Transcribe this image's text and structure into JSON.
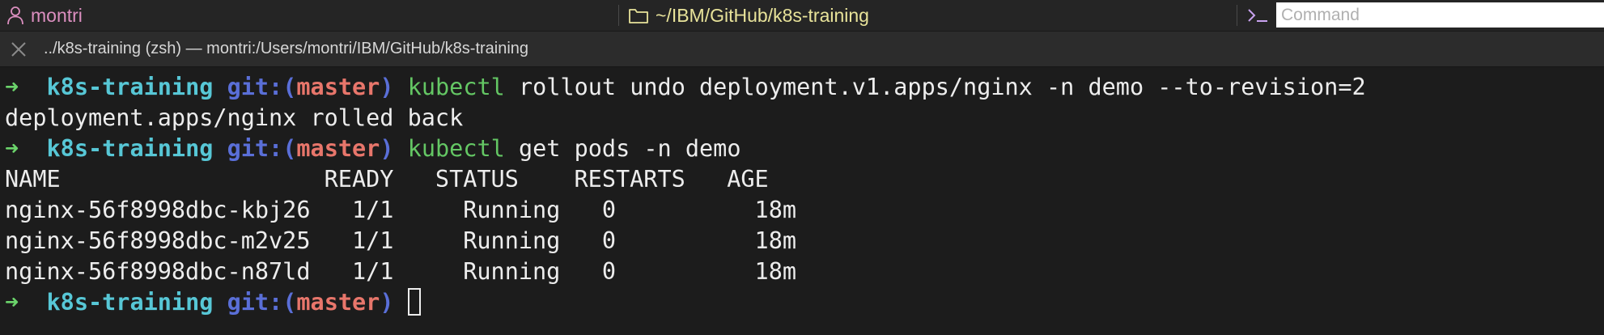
{
  "statusbar": {
    "user": "montri",
    "path": "~/IBM/GitHub/k8s-training",
    "command_placeholder": "Command"
  },
  "tab": {
    "title": "../k8s-training (zsh) — montri:/Users/montri/IBM/GitHub/k8s-training"
  },
  "prompt": {
    "arrow": "➜",
    "dir": "k8s-training",
    "git_label": "git:",
    "git_open": "(",
    "branch": "master",
    "git_close": ")"
  },
  "session": {
    "cmd1_name": "kubectl",
    "cmd1_args": "rollout undo deployment.v1.apps/nginx -n demo --to-revision=2",
    "output1": "deployment.apps/nginx rolled back",
    "cmd2_name": "kubectl",
    "cmd2_args": "get pods -n demo",
    "pods_header": "NAME                   READY   STATUS    RESTARTS   AGE",
    "pods_rows": [
      "nginx-56f8998dbc-kbj26   1/1     Running   0          18m",
      "nginx-56f8998dbc-m2v25   1/1     Running   0          18m",
      "nginx-56f8998dbc-n87ld   1/1     Running   0          18m"
    ]
  },
  "icons": {
    "user": "person-icon",
    "folder": "folder-icon",
    "prompt": "terminal-prompt-icon",
    "close": "close-icon"
  },
  "colors": {
    "user_text": "#dc8fc0",
    "path_text": "#e8e39a",
    "arrow": "#6bd46b",
    "dir": "#57c7d6",
    "git": "#5a6fd8",
    "branch": "#e8766b",
    "command": "#64c764",
    "background": "#1c1c1c"
  }
}
